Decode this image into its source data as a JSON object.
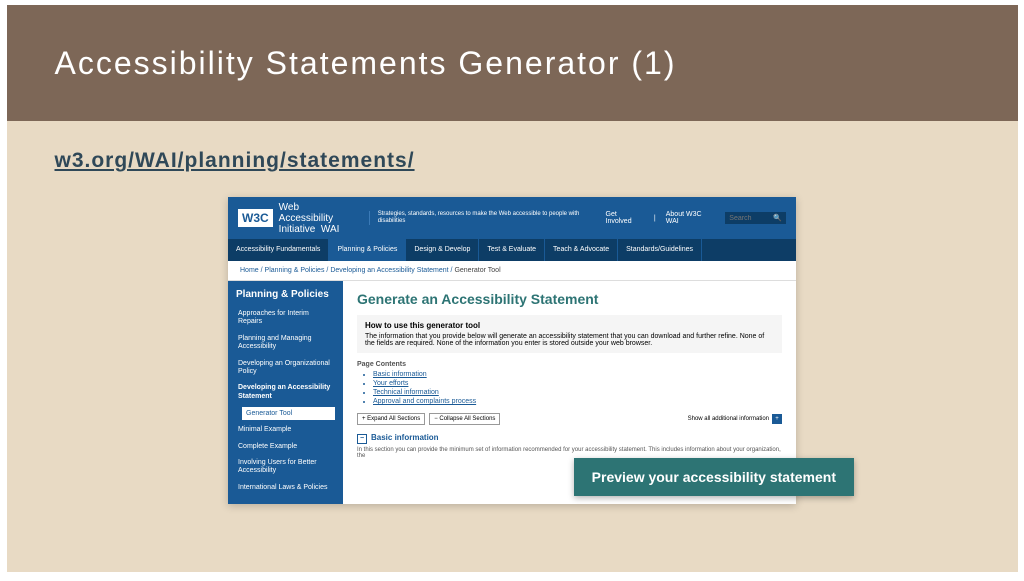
{
  "slide": {
    "title": "Accessibility Statements Generator (1)",
    "url": "w3.org/WAI/planning/statements/"
  },
  "header": {
    "logo": "W3C",
    "brand_line1": "Web Accessibility",
    "brand_line2": "Initiative",
    "brand_suffix": "WAI",
    "tagline": "Strategies, standards, resources to make the Web accessible to people with disabilities",
    "link1": "Get Involved",
    "link2": "About W3C WAI",
    "search": "Search"
  },
  "nav": [
    "Accessibility Fundamentals",
    "Planning & Policies",
    "Design & Develop",
    "Test & Evaluate",
    "Teach & Advocate",
    "Standards/Guidelines"
  ],
  "breadcrumb": {
    "p1": "Home",
    "p2": "Planning & Policies",
    "p3": "Developing an Accessibility Statement",
    "p4": "Generator Tool"
  },
  "sidebar": {
    "title": "Planning & Policies",
    "items": [
      "Approaches for Interim Repairs",
      "Planning and Managing Accessibility",
      "Developing an Organizational Policy",
      "Developing an Accessibility Statement"
    ],
    "sub": "Generator Tool",
    "items2": [
      "Minimal Example",
      "Complete Example",
      "Involving Users for Better Accessibility",
      "International Laws & Policies"
    ]
  },
  "main": {
    "h2": "Generate an Accessibility Statement",
    "howto_title": "How to use this generator tool",
    "howto_text": "The information that you provide below will generate an accessibility statement that you can download and further refine. None of the fields are required. None of the information you enter is stored outside your web browser.",
    "pc_label": "Page Contents",
    "pc": [
      "Basic information",
      "Your efforts",
      "Technical information",
      "Approval and complaints process"
    ],
    "expand": "+ Expand All Sections",
    "collapse": "− Collapse All Sections",
    "show_additional": "Show all additional information",
    "sec1_title": "Basic information",
    "sec1_text": "In this section you can provide the minimum set of information recommended for your accessibility statement. This includes information about your organization, the"
  },
  "preview_button": "Preview your accessibility statement"
}
